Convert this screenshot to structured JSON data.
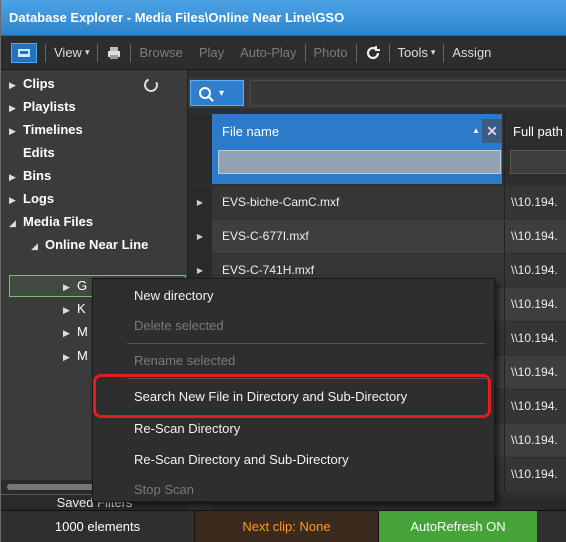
{
  "window": {
    "title": "Database Explorer - Media Files\\Online Near Line\\GSO"
  },
  "toolbar": {
    "view": "View",
    "browse": "Browse",
    "play": "Play",
    "autoplay": "Auto-Play",
    "photo": "Photo",
    "tools": "Tools",
    "assign": "Assign"
  },
  "sidebar": {
    "clips": "Clips",
    "playlists": "Playlists",
    "timelines": "Timelines",
    "edits": "Edits",
    "bins": "Bins",
    "logs": "Logs",
    "media_files": "Media Files",
    "online_near_line": "Online Near Line",
    "child_g": "G",
    "child_k": "K",
    "child_m1": "M",
    "child_m2": "M",
    "saved_filters": "Saved Filters"
  },
  "grid": {
    "col_file": "File name",
    "col_path": "Full path",
    "rows": [
      {
        "name": "EVS-biche-CamC.mxf",
        "path": "\\\\10.194."
      },
      {
        "name": "EVS-C-677I.mxf",
        "path": "\\\\10.194."
      },
      {
        "name": "EVS-C-741H.mxf",
        "path": "\\\\10.194."
      },
      {
        "name": "",
        "path": "\\\\10.194."
      },
      {
        "name": "",
        "path": "\\\\10.194."
      },
      {
        "name": "",
        "path": "\\\\10.194."
      },
      {
        "name": "",
        "path": "\\\\10.194."
      },
      {
        "name": "",
        "path": "\\\\10.194."
      },
      {
        "name": "",
        "path": "\\\\10.194."
      }
    ]
  },
  "context_menu": {
    "new_directory": "New directory",
    "delete_selected": "Delete selected",
    "rename_selected": "Rename selected",
    "search_new": "Search New File in Directory and Sub-Directory",
    "rescan_dir": "Re-Scan Directory",
    "rescan_dir_sub": "Re-Scan Directory and Sub-Directory",
    "stop_scan": "Stop Scan"
  },
  "status": {
    "elements": "1000 elements",
    "next_clip": "Next clip: None",
    "autorefresh": "AutoRefresh ON"
  },
  "colors": {
    "title_blue": "#2c84cc",
    "header_blue": "#2b7bc8",
    "highlight_red": "#e0201f",
    "next_orange": "#ff9a1f",
    "autorefresh_green": "#45a33a"
  }
}
